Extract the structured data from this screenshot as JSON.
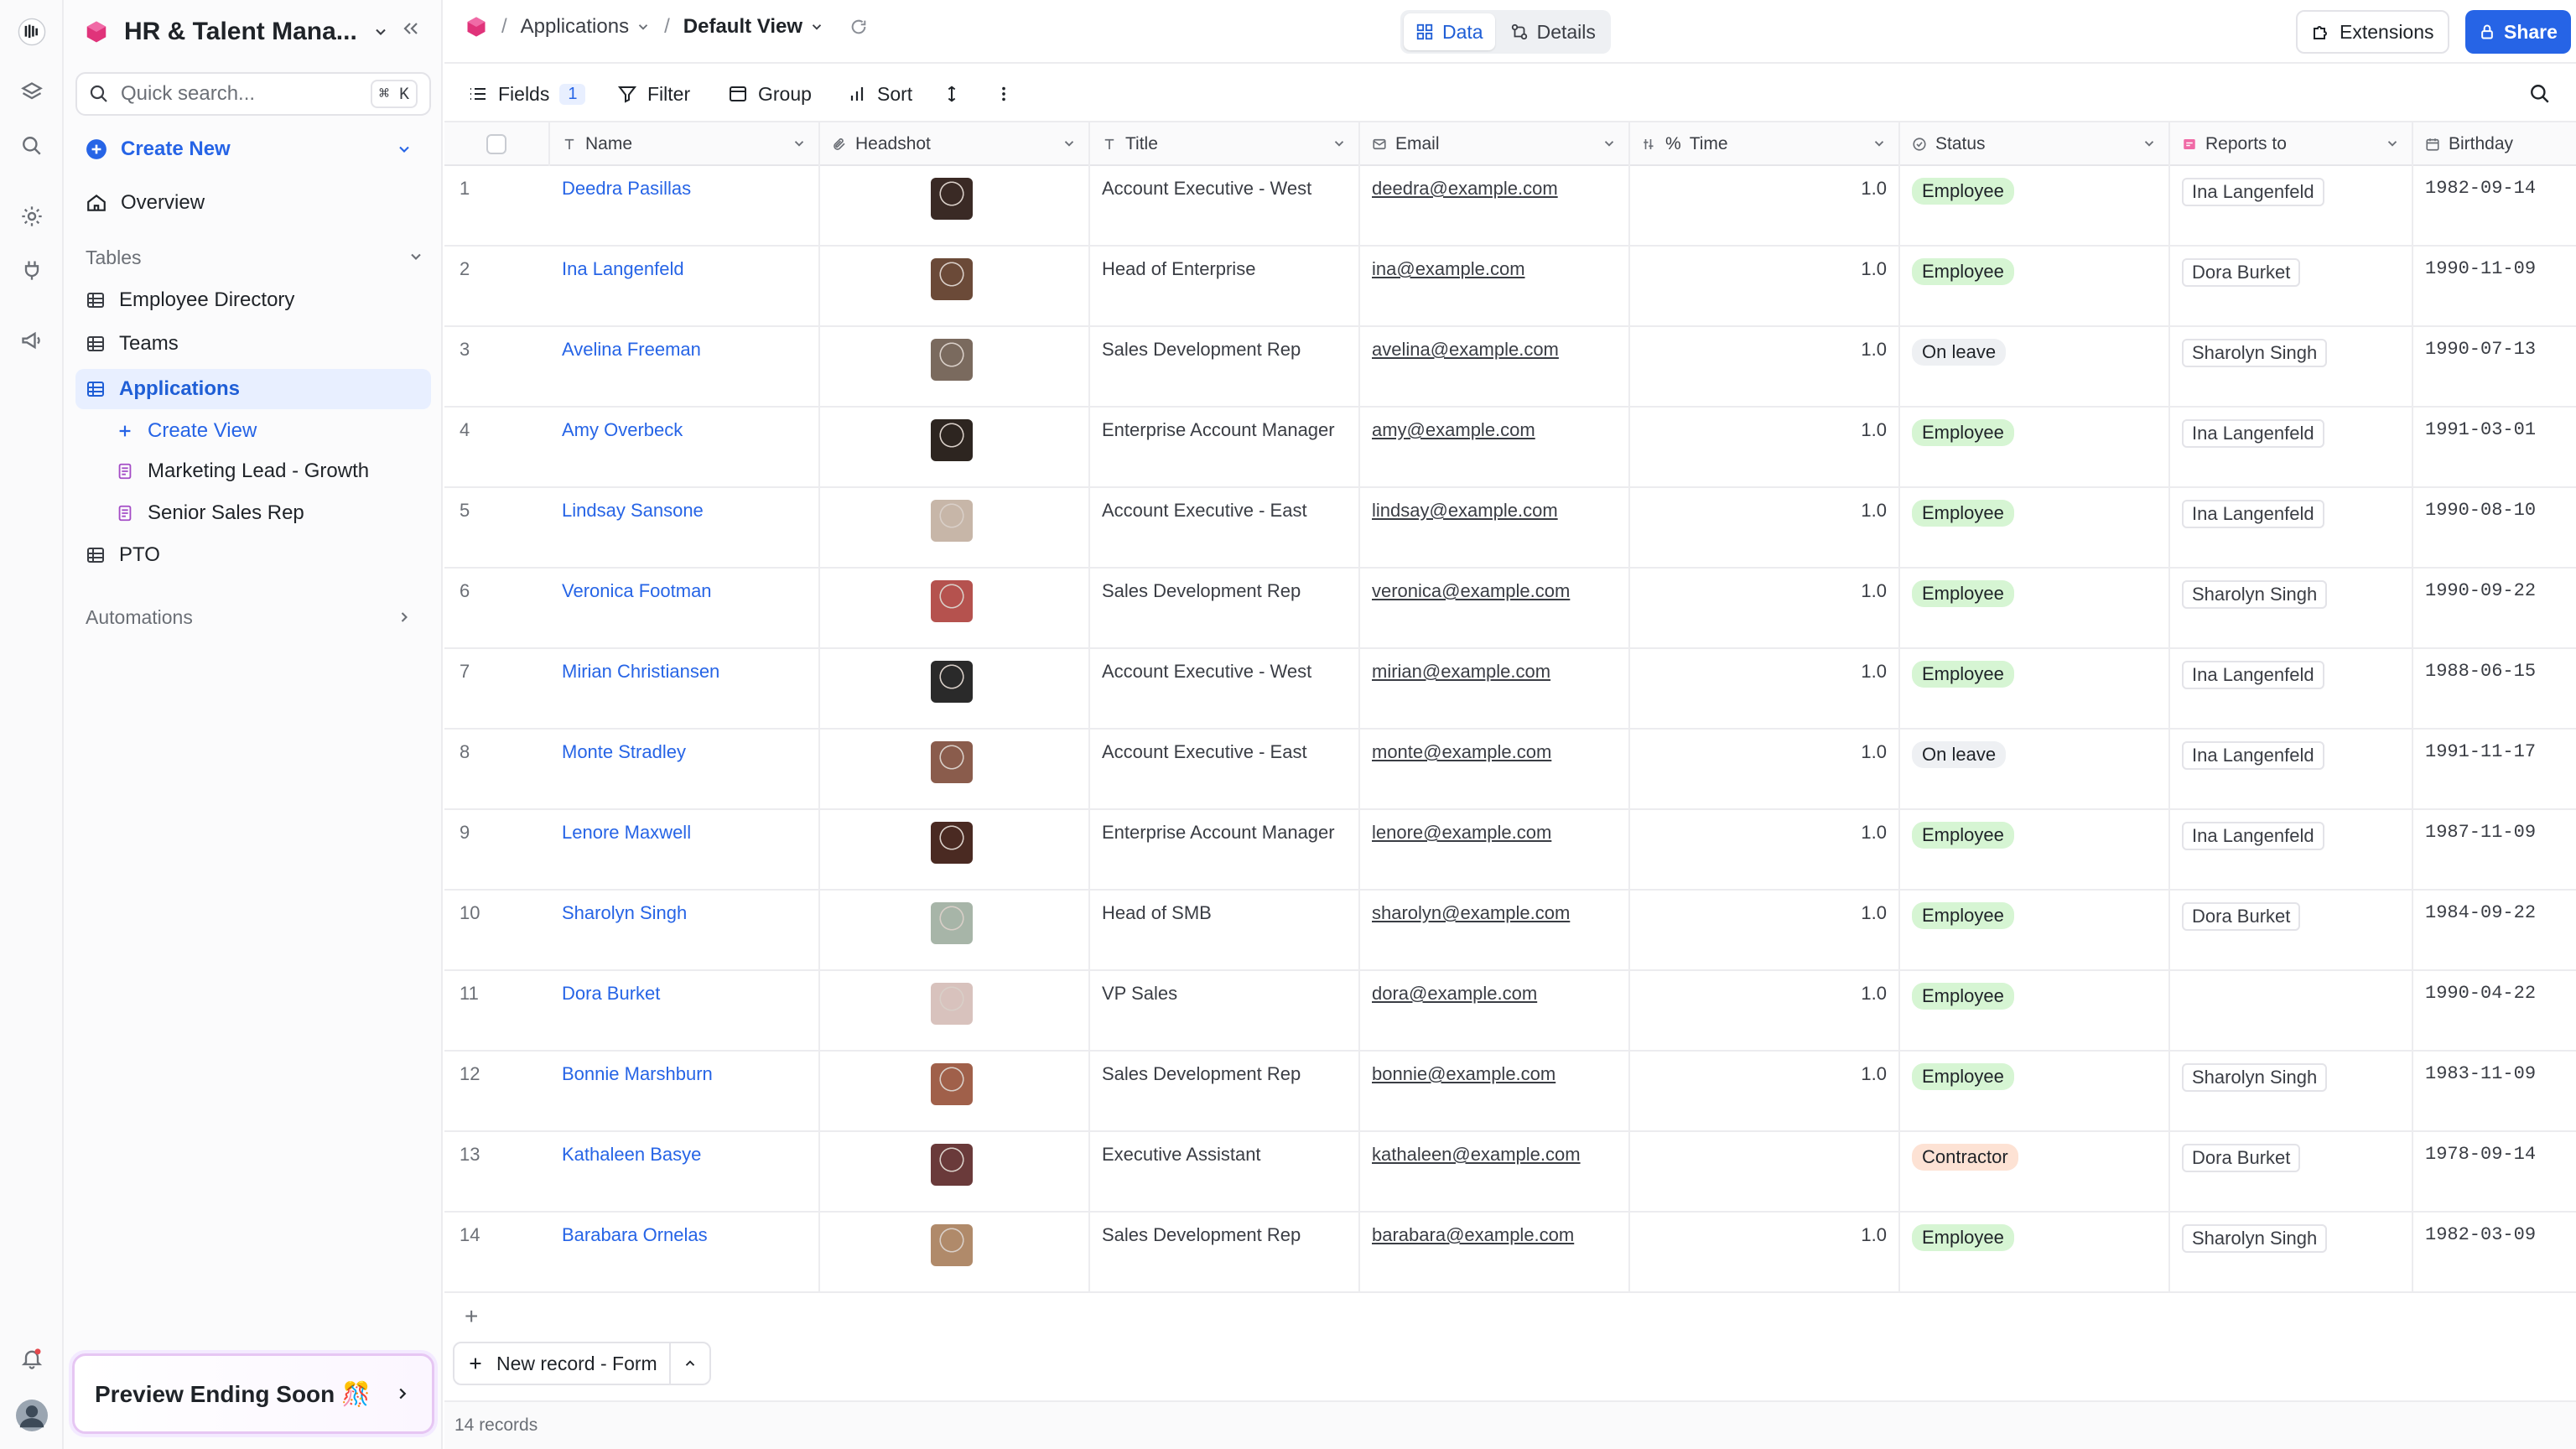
{
  "workspace": {
    "title": "HR & Talent Mana..."
  },
  "search": {
    "placeholder": "Quick search...",
    "shortcut": "⌘ K"
  },
  "sidebar": {
    "create_new": "Create New",
    "overview": "Overview",
    "tables_label": "Tables",
    "tables": [
      {
        "label": "Employee Directory"
      },
      {
        "label": "Teams"
      },
      {
        "label": "Applications"
      },
      {
        "label": "PTO"
      }
    ],
    "views": [
      {
        "label": "Create View"
      },
      {
        "label": "Marketing Lead - Growth"
      },
      {
        "label": "Senior Sales Rep"
      }
    ],
    "automations": "Automations",
    "preview": "Preview Ending Soon"
  },
  "breadcrumb": {
    "sep": "/",
    "table": "Applications",
    "view": "Default View"
  },
  "view_toggle": {
    "data": "Data",
    "details": "Details"
  },
  "header_actions": {
    "extensions": "Extensions",
    "share": "Share"
  },
  "toolbar": {
    "fields": "Fields",
    "fields_count": "1",
    "filter": "Filter",
    "group": "Group",
    "sort": "Sort"
  },
  "columns": {
    "name": "Name",
    "headshot": "Headshot",
    "title": "Title",
    "email": "Email",
    "time": "Time",
    "status": "Status",
    "reports_to": "Reports to",
    "birthday": "Birthday"
  },
  "status_colors": {
    "Employee": "#d6f5d3",
    "On leave": "#eef0f3",
    "Contractor": "#fde2d4"
  },
  "avatar_colors": [
    "#3a2a25",
    "#6b4a38",
    "#7a6a5e",
    "#2d2520",
    "#c7b6a8",
    "#b5524e",
    "#2a2a2a",
    "#8a5c4c",
    "#4a2a22",
    "#a7b5a8",
    "#d8c2bd",
    "#a0604a",
    "#6a3a3a",
    "#b08a6a"
  ],
  "rows": [
    {
      "n": "1",
      "name": "Deedra Pasillas",
      "title": "Account Executive - West",
      "email": "deedra@example.com",
      "time": "1.0",
      "status": "Employee",
      "reports": "Ina Langenfeld",
      "bday": "1982-09-14"
    },
    {
      "n": "2",
      "name": "Ina Langenfeld",
      "title": "Head of Enterprise",
      "email": "ina@example.com",
      "time": "1.0",
      "status": "Employee",
      "reports": "Dora Burket",
      "bday": "1990-11-09"
    },
    {
      "n": "3",
      "name": "Avelina Freeman",
      "title": "Sales Development Rep",
      "email": "avelina@example.com",
      "time": "1.0",
      "status": "On leave",
      "reports": "Sharolyn Singh",
      "bday": "1990-07-13"
    },
    {
      "n": "4",
      "name": "Amy Overbeck",
      "title": "Enterprise Account Manager",
      "email": "amy@example.com",
      "time": "1.0",
      "status": "Employee",
      "reports": "Ina Langenfeld",
      "bday": "1991-03-01"
    },
    {
      "n": "5",
      "name": "Lindsay Sansone",
      "title": "Account Executive - East",
      "email": "lindsay@example.com",
      "time": "1.0",
      "status": "Employee",
      "reports": "Ina Langenfeld",
      "bday": "1990-08-10"
    },
    {
      "n": "6",
      "name": "Veronica Footman",
      "title": "Sales Development Rep",
      "email": "veronica@example.com",
      "time": "1.0",
      "status": "Employee",
      "reports": "Sharolyn Singh",
      "bday": "1990-09-22"
    },
    {
      "n": "7",
      "name": "Mirian Christiansen",
      "title": "Account Executive - West",
      "email": "mirian@example.com",
      "time": "1.0",
      "status": "Employee",
      "reports": "Ina Langenfeld",
      "bday": "1988-06-15"
    },
    {
      "n": "8",
      "name": "Monte Stradley",
      "title": "Account Executive - East",
      "email": "monte@example.com",
      "time": "1.0",
      "status": "On leave",
      "reports": "Ina Langenfeld",
      "bday": "1991-11-17"
    },
    {
      "n": "9",
      "name": "Lenore Maxwell",
      "title": "Enterprise Account Manager",
      "email": "lenore@example.com",
      "time": "1.0",
      "status": "Employee",
      "reports": "Ina Langenfeld",
      "bday": "1987-11-09"
    },
    {
      "n": "10",
      "name": "Sharolyn Singh",
      "title": "Head of SMB",
      "email": "sharolyn@example.com",
      "time": "1.0",
      "status": "Employee",
      "reports": "Dora Burket",
      "bday": "1984-09-22"
    },
    {
      "n": "11",
      "name": "Dora Burket",
      "title": "VP Sales",
      "email": "dora@example.com",
      "time": "1.0",
      "status": "Employee",
      "reports": "",
      "bday": "1990-04-22"
    },
    {
      "n": "12",
      "name": "Bonnie Marshburn",
      "title": "Sales Development Rep",
      "email": "bonnie@example.com",
      "time": "1.0",
      "status": "Employee",
      "reports": "Sharolyn Singh",
      "bday": "1983-11-09"
    },
    {
      "n": "13",
      "name": "Kathaleen Basye",
      "title": "Executive Assistant",
      "email": "kathaleen@example.com",
      "time": "",
      "status": "Contractor",
      "reports": "Dora Burket",
      "bday": "1978-09-14"
    },
    {
      "n": "14",
      "name": "Barabara Ornelas",
      "title": "Sales Development Rep",
      "email": "barabara@example.com",
      "time": "1.0",
      "status": "Employee",
      "reports": "Sharolyn Singh",
      "bday": "1982-03-09"
    }
  ],
  "footer": {
    "new_record": "New record - Form",
    "records_count": "14 records"
  }
}
